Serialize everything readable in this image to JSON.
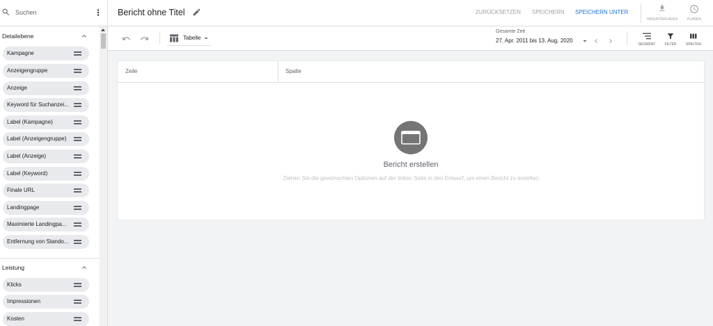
{
  "search": {
    "placeholder": "Suchen"
  },
  "sidebar": {
    "sections": [
      {
        "title": "Detailebene",
        "expanded": true,
        "items": [
          "Kampagne",
          "Anzeigengruppe",
          "Anzeige",
          "Keyword für Suchanzei...",
          "Label (Kampagne)",
          "Label (Anzeigengruppe)",
          "Label (Anzeige)",
          "Label (Keyword)",
          "Finale URL",
          "Landingpage",
          "Maximierte Landingpa...",
          "Entfernung von Stando..."
        ]
      },
      {
        "title": "Leistung",
        "expanded": true,
        "items": [
          "Klicks",
          "Impressionen",
          "Kosten"
        ]
      }
    ]
  },
  "header": {
    "title": "Bericht ohne Titel",
    "reset_label": "ZURÜCKSETZEN",
    "save_label": "SPEICHERN",
    "save_as_label": "SPEICHERN UNTER",
    "download_label": "HERUNTERLADEN",
    "schedule_label": "PLANEN"
  },
  "toolbar": {
    "visualization": "Tabelle",
    "date_range_label": "Gesamte Zeit",
    "date_range": "27. Apr. 2011 bis 13. Aug. 2020",
    "segment_label": "SEGMENT",
    "filter_label": "FILTER",
    "columns_label": "SPALTEN"
  },
  "report": {
    "row_header": "Zeile",
    "column_header": "Spalte",
    "empty_title": "Bericht erstellen",
    "empty_hint": "Ziehen Sie die gewünschten Optionen auf der linken Seite in den Entwurf, um einen Bericht zu erstellen"
  },
  "state": {
    "reset_enabled": false,
    "save_enabled": false,
    "save_as_enabled": true,
    "download_enabled": false,
    "schedule_enabled": false,
    "undo_enabled": false,
    "redo_enabled": false
  },
  "icons": [
    "search-icon",
    "more-vert-icon",
    "chevron-up-icon",
    "drag-handle-icon",
    "edit-icon",
    "download-icon",
    "schedule-icon",
    "undo-icon",
    "redo-icon",
    "table-icon",
    "dropdown-arrow-icon",
    "chevron-left-icon",
    "chevron-right-icon",
    "segment-icon",
    "filter-icon",
    "columns-icon",
    "report-window-icon"
  ],
  "colors": {
    "accent": "#1a73e8",
    "disabled_text": "#9aa0a6",
    "chip_background": "#e8eaed",
    "canvas_background": "#f1f3f4",
    "empty_state_icon": "#757575"
  }
}
